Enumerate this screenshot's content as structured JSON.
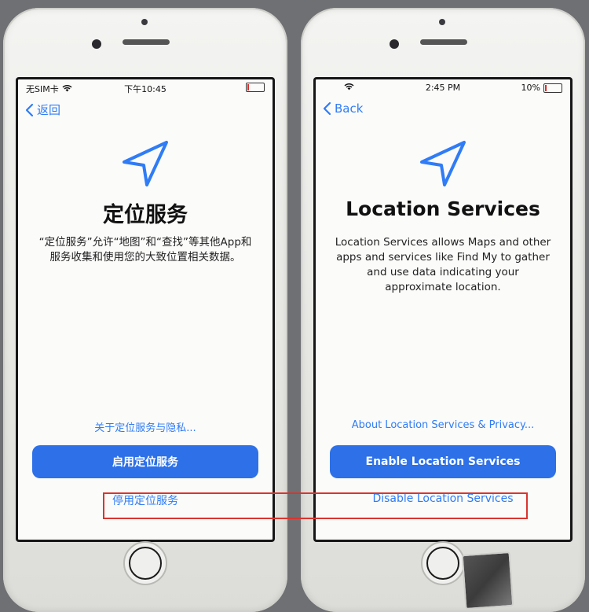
{
  "left_phone": {
    "status": {
      "carrier": "无SIM卡",
      "time": "下午10:45"
    },
    "back_label": "返回",
    "title": "定位服务",
    "description": "“定位服务”允许“地图”和“查找”等其他App和服务收集和使用您的大致位置相关数据。",
    "privacy_link": "关于定位服务与隐私...",
    "enable_button": "启用定位服务",
    "disable_link": "停用定位服务",
    "battery_level": 0.08
  },
  "right_phone": {
    "status": {
      "time": "2:45 PM",
      "battery": "10%"
    },
    "back_label": "Back",
    "title": "Location Services",
    "description": "Location Services allows Maps and other apps and services like Find My to gather and use data indicating your approximate location.",
    "privacy_link": "About Location Services & Privacy...",
    "enable_button": "Enable Location Services",
    "disable_link": "Disable Location Services",
    "battery_level": 0.1
  },
  "colors": {
    "accent": "#2f7cf6",
    "button": "#2d70e7",
    "highlight": "#d9352f"
  },
  "icons": [
    "location-arrow-icon",
    "wifi-icon",
    "battery-icon",
    "chevron-left-icon"
  ]
}
